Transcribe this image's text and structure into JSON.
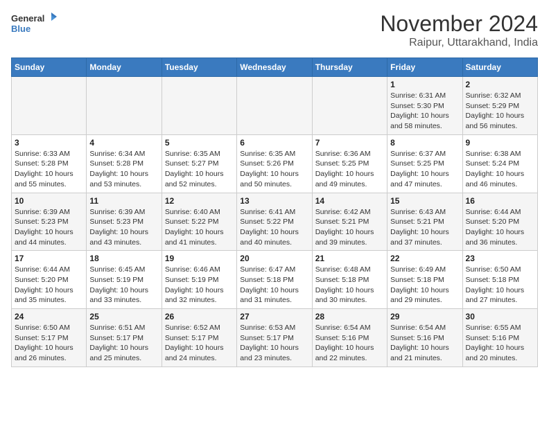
{
  "header": {
    "logo_line1": "General",
    "logo_line2": "Blue",
    "title": "November 2024",
    "subtitle": "Raipur, Uttarakhand, India"
  },
  "weekdays": [
    "Sunday",
    "Monday",
    "Tuesday",
    "Wednesday",
    "Thursday",
    "Friday",
    "Saturday"
  ],
  "weeks": [
    [
      {
        "day": "",
        "info": ""
      },
      {
        "day": "",
        "info": ""
      },
      {
        "day": "",
        "info": ""
      },
      {
        "day": "",
        "info": ""
      },
      {
        "day": "",
        "info": ""
      },
      {
        "day": "1",
        "info": "Sunrise: 6:31 AM\nSunset: 5:30 PM\nDaylight: 10 hours and 58 minutes."
      },
      {
        "day": "2",
        "info": "Sunrise: 6:32 AM\nSunset: 5:29 PM\nDaylight: 10 hours and 56 minutes."
      }
    ],
    [
      {
        "day": "3",
        "info": "Sunrise: 6:33 AM\nSunset: 5:28 PM\nDaylight: 10 hours and 55 minutes."
      },
      {
        "day": "4",
        "info": "Sunrise: 6:34 AM\nSunset: 5:28 PM\nDaylight: 10 hours and 53 minutes."
      },
      {
        "day": "5",
        "info": "Sunrise: 6:35 AM\nSunset: 5:27 PM\nDaylight: 10 hours and 52 minutes."
      },
      {
        "day": "6",
        "info": "Sunrise: 6:35 AM\nSunset: 5:26 PM\nDaylight: 10 hours and 50 minutes."
      },
      {
        "day": "7",
        "info": "Sunrise: 6:36 AM\nSunset: 5:25 PM\nDaylight: 10 hours and 49 minutes."
      },
      {
        "day": "8",
        "info": "Sunrise: 6:37 AM\nSunset: 5:25 PM\nDaylight: 10 hours and 47 minutes."
      },
      {
        "day": "9",
        "info": "Sunrise: 6:38 AM\nSunset: 5:24 PM\nDaylight: 10 hours and 46 minutes."
      }
    ],
    [
      {
        "day": "10",
        "info": "Sunrise: 6:39 AM\nSunset: 5:23 PM\nDaylight: 10 hours and 44 minutes."
      },
      {
        "day": "11",
        "info": "Sunrise: 6:39 AM\nSunset: 5:23 PM\nDaylight: 10 hours and 43 minutes."
      },
      {
        "day": "12",
        "info": "Sunrise: 6:40 AM\nSunset: 5:22 PM\nDaylight: 10 hours and 41 minutes."
      },
      {
        "day": "13",
        "info": "Sunrise: 6:41 AM\nSunset: 5:22 PM\nDaylight: 10 hours and 40 minutes."
      },
      {
        "day": "14",
        "info": "Sunrise: 6:42 AM\nSunset: 5:21 PM\nDaylight: 10 hours and 39 minutes."
      },
      {
        "day": "15",
        "info": "Sunrise: 6:43 AM\nSunset: 5:21 PM\nDaylight: 10 hours and 37 minutes."
      },
      {
        "day": "16",
        "info": "Sunrise: 6:44 AM\nSunset: 5:20 PM\nDaylight: 10 hours and 36 minutes."
      }
    ],
    [
      {
        "day": "17",
        "info": "Sunrise: 6:44 AM\nSunset: 5:20 PM\nDaylight: 10 hours and 35 minutes."
      },
      {
        "day": "18",
        "info": "Sunrise: 6:45 AM\nSunset: 5:19 PM\nDaylight: 10 hours and 33 minutes."
      },
      {
        "day": "19",
        "info": "Sunrise: 6:46 AM\nSunset: 5:19 PM\nDaylight: 10 hours and 32 minutes."
      },
      {
        "day": "20",
        "info": "Sunrise: 6:47 AM\nSunset: 5:18 PM\nDaylight: 10 hours and 31 minutes."
      },
      {
        "day": "21",
        "info": "Sunrise: 6:48 AM\nSunset: 5:18 PM\nDaylight: 10 hours and 30 minutes."
      },
      {
        "day": "22",
        "info": "Sunrise: 6:49 AM\nSunset: 5:18 PM\nDaylight: 10 hours and 29 minutes."
      },
      {
        "day": "23",
        "info": "Sunrise: 6:50 AM\nSunset: 5:18 PM\nDaylight: 10 hours and 27 minutes."
      }
    ],
    [
      {
        "day": "24",
        "info": "Sunrise: 6:50 AM\nSunset: 5:17 PM\nDaylight: 10 hours and 26 minutes."
      },
      {
        "day": "25",
        "info": "Sunrise: 6:51 AM\nSunset: 5:17 PM\nDaylight: 10 hours and 25 minutes."
      },
      {
        "day": "26",
        "info": "Sunrise: 6:52 AM\nSunset: 5:17 PM\nDaylight: 10 hours and 24 minutes."
      },
      {
        "day": "27",
        "info": "Sunrise: 6:53 AM\nSunset: 5:17 PM\nDaylight: 10 hours and 23 minutes."
      },
      {
        "day": "28",
        "info": "Sunrise: 6:54 AM\nSunset: 5:16 PM\nDaylight: 10 hours and 22 minutes."
      },
      {
        "day": "29",
        "info": "Sunrise: 6:54 AM\nSunset: 5:16 PM\nDaylight: 10 hours and 21 minutes."
      },
      {
        "day": "30",
        "info": "Sunrise: 6:55 AM\nSunset: 5:16 PM\nDaylight: 10 hours and 20 minutes."
      }
    ]
  ]
}
